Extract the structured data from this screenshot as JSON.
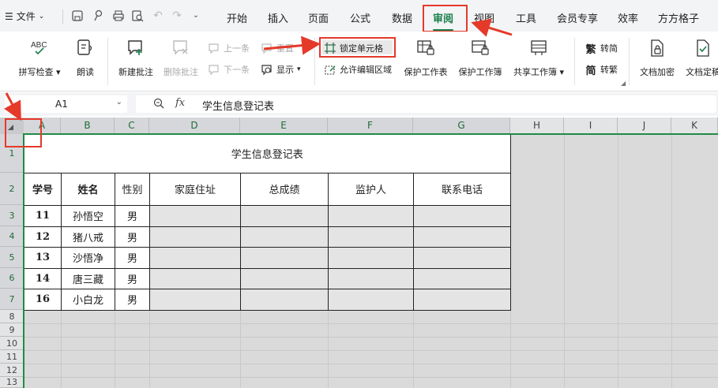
{
  "menubar": {
    "file_label": "文件",
    "tabs": [
      "开始",
      "插入",
      "页面",
      "公式",
      "数据",
      "审阅",
      "视图",
      "工具",
      "会员专享",
      "效率",
      "方方格子"
    ],
    "active_tab": "审阅"
  },
  "ribbon": {
    "spell_check": "拼写检查",
    "read_aloud": "朗读",
    "new_comment": "新建批注",
    "delete_comment": "删除批注",
    "prev_item": "上一条",
    "next_item": "下一条",
    "reset": "重置",
    "show": "显示",
    "lock_cell": "锁定单元格",
    "allow_edit_range": "允许编辑区域",
    "protect_sheet": "保护工作表",
    "protect_workbook": "保护工作簿",
    "share_workbook": "共享工作簿",
    "to_simplified": "转简",
    "to_traditional": "转繁",
    "doc_encrypt": "文档加密",
    "doc_finalize": "文档定稿"
  },
  "formula_bar": {
    "name_box": "A1",
    "fx": "fx",
    "content": "学生信息登记表"
  },
  "grid": {
    "columns": [
      "A",
      "B",
      "C",
      "D",
      "E",
      "F",
      "G",
      "H",
      "I",
      "J",
      "K"
    ],
    "rows": [
      "1",
      "2",
      "3",
      "4",
      "5",
      "6",
      "7",
      "8",
      "9",
      "10",
      "11",
      "12",
      "13"
    ]
  },
  "table": {
    "title": "学生信息登记表",
    "headers": [
      "学号",
      "姓名",
      "性别",
      "家庭住址",
      "总成绩",
      "监护人",
      "联系电话"
    ],
    "rows": [
      [
        "11",
        "孙悟空",
        "男"
      ],
      [
        "12",
        "猪八戒",
        "男"
      ],
      [
        "13",
        "沙悟净",
        "男"
      ],
      [
        "14",
        "唐三藏",
        "男"
      ],
      [
        "16",
        "小白龙",
        "男"
      ]
    ]
  },
  "colors": {
    "accent": "#1a7f4b",
    "annotation": "#e5392a"
  }
}
